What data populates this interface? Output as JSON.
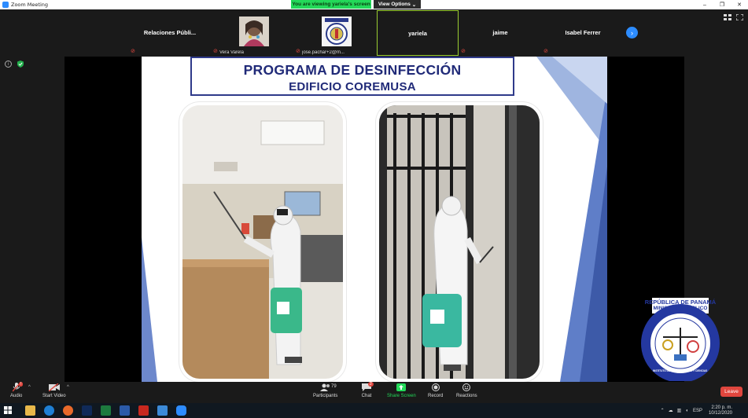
{
  "window": {
    "app_title": "Zoom Meeting",
    "viewing_banner": "You are viewing yariela's screen",
    "view_options": "View Options",
    "controls": [
      "–",
      "❐",
      "✕"
    ]
  },
  "participants": [
    {
      "name": "Relaciones  Públi...",
      "label": "",
      "has_photo": false,
      "active": false
    },
    {
      "name": "",
      "label": "Vera Varela",
      "has_photo": true,
      "active": false
    },
    {
      "name": "",
      "label": "jose.pachar+2@m...",
      "has_photo": true,
      "active": false
    },
    {
      "name": "yariela",
      "label": "",
      "has_photo": false,
      "active": true
    },
    {
      "name": "jaime",
      "label": "",
      "has_photo": false,
      "active": false
    },
    {
      "name": "Isabel Ferrer",
      "label": "",
      "has_photo": false,
      "active": false
    }
  ],
  "slide": {
    "title_line1": "PROGRAMA DE DESINFECCIÓN",
    "title_line2": "EDIFICIO COREMUSA"
  },
  "logo": {
    "top_line1": "REPÚBLICA DE PANAMÁ",
    "top_line2": "MINISTERIO PÚBLICO",
    "ring_text": "INSTITUTO DE MEDICINA LEGAL Y CIENCIAS FORENSES"
  },
  "toolbar": {
    "audio": "Audio",
    "start_video": "Start Video",
    "participants": "Participants",
    "participants_count": "79",
    "chat": "Chat",
    "chat_badge": "2",
    "share_screen": "Share Screen",
    "record": "Record",
    "reactions": "Reactions",
    "leave": "Leave"
  },
  "taskbar": {
    "language": "ESP",
    "time": "2:20 p. m.",
    "date": "10/12/2020"
  },
  "colors": {
    "zoom_blue": "#2d8cff",
    "share_green": "#23d959",
    "leave_red": "#e0463e",
    "title_navy": "#202a78"
  }
}
